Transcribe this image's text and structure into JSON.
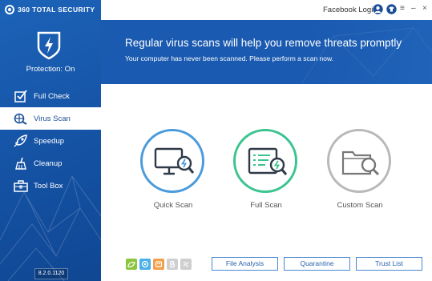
{
  "brand": {
    "name": "360 TOTAL SECURITY"
  },
  "topbar": {
    "facebook_login": "Facebook Login",
    "icons": [
      "user-icon",
      "shirt-icon"
    ],
    "window_buttons": {
      "menu": "≡",
      "minimize": "–",
      "close": "×"
    }
  },
  "sidebar": {
    "protection_status": "Protection: On",
    "items": [
      {
        "label": "Full Check",
        "icon": "checkbox-icon",
        "active": false
      },
      {
        "label": "Virus Scan",
        "icon": "bug-scan-icon",
        "active": true
      },
      {
        "label": "Speedup",
        "icon": "rocket-icon",
        "active": false
      },
      {
        "label": "Cleanup",
        "icon": "broom-icon",
        "active": false
      },
      {
        "label": "Tool Box",
        "icon": "toolbox-icon",
        "active": false
      }
    ],
    "version": "8.2.0.1120"
  },
  "banner": {
    "title": "Regular virus scans will help you remove threats promptly",
    "subtitle": "Your computer has never been scanned. Please perform a scan now."
  },
  "scan_options": [
    {
      "label": "Quick Scan",
      "color": "#4a9bdc",
      "icon": "monitor-search-icon"
    },
    {
      "label": "Full Scan",
      "color": "#3cc490",
      "icon": "list-search-icon"
    },
    {
      "label": "Custom Scan",
      "color": "#b9b9b9",
      "icon": "folder-search-icon"
    }
  ],
  "bottom": {
    "engine_icons": [
      {
        "name": "engine-green-icon",
        "color": "#8cc63f"
      },
      {
        "name": "engine-blue-icon",
        "color": "#4ab0e8"
      },
      {
        "name": "engine-orange-icon",
        "color": "#f0a04a"
      },
      {
        "name": "engine-gray-b-icon",
        "color": "#cfcfcf"
      },
      {
        "name": "engine-gray-link-icon",
        "color": "#cfcfcf"
      }
    ],
    "buttons": [
      "File Analysis",
      "Quarantine",
      "Trust List"
    ]
  },
  "colors": {
    "primary": "#1a5ab0",
    "sidebar": "#1552a4",
    "quick": "#4a9bdc",
    "full": "#3cc490",
    "custom": "#b9b9b9"
  }
}
